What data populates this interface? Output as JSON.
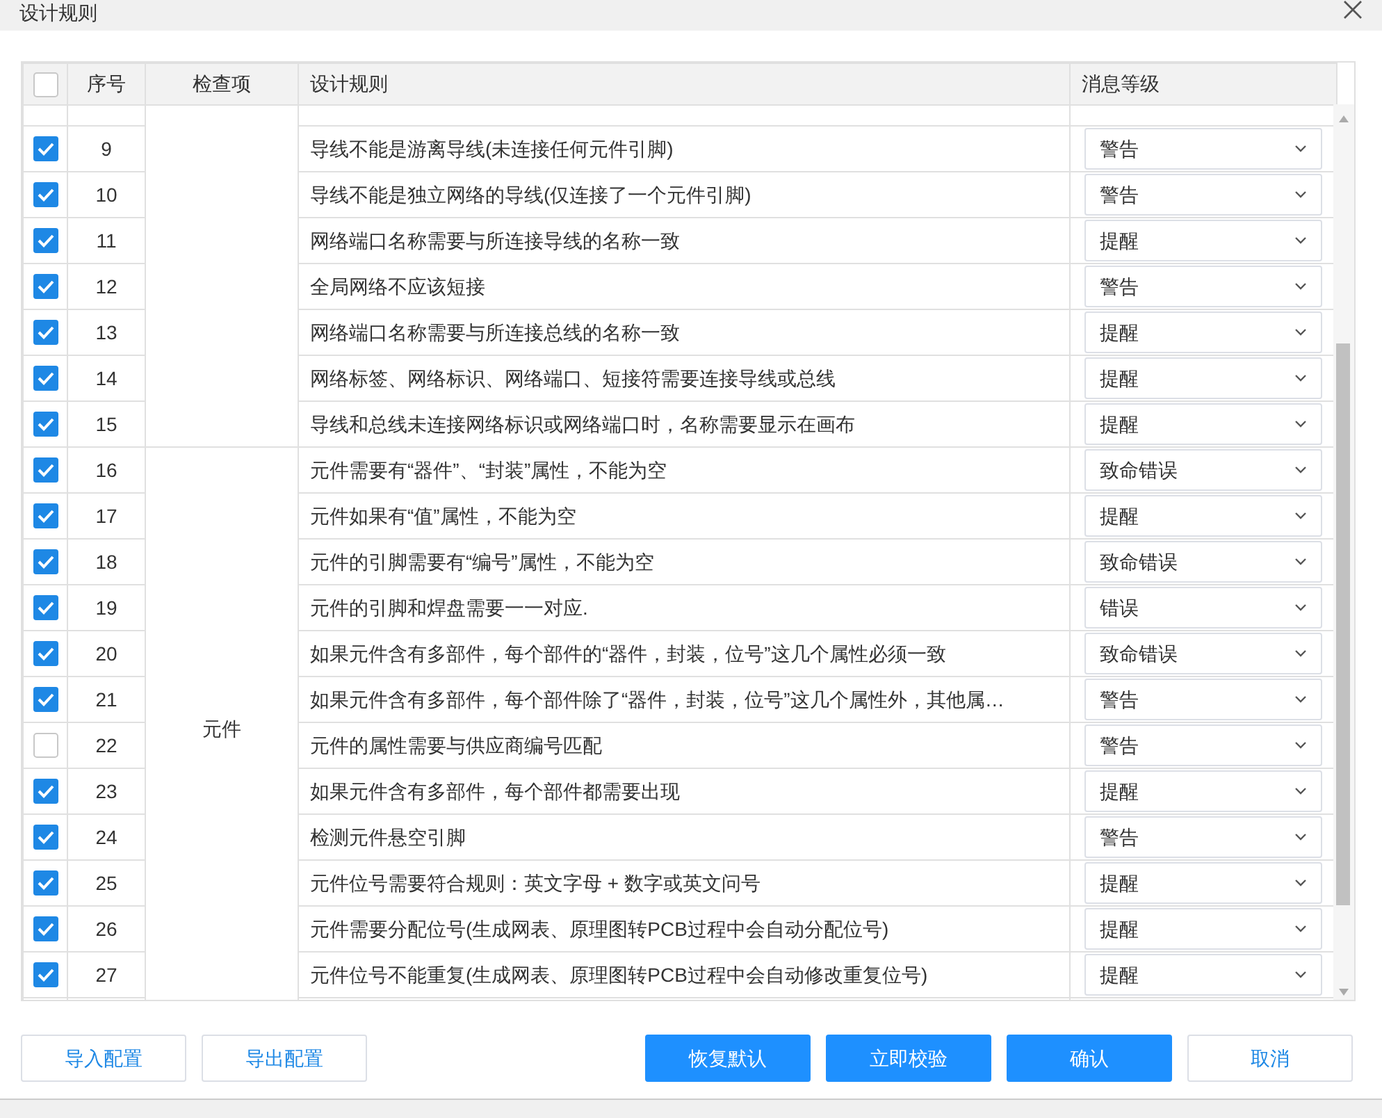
{
  "window": {
    "title": "设计规则"
  },
  "table": {
    "columns": [
      "序号",
      "检查项",
      "设计规则",
      "消息等级"
    ],
    "header_checked": false,
    "groups": [
      {
        "rows": [
          {
            "no": "9",
            "rule": "导线不能是游离导线(未连接任何元件引脚)",
            "level_text": "警告",
            "checked": true
          },
          {
            "no": "10",
            "rule": "导线不能是独立网络的导线(仅连接了一个元件引脚)",
            "level_text": "警告",
            "checked": true
          },
          {
            "no": "11",
            "rule": "网络端口名称需要与所连接导线的名称一致",
            "level_text": "提醒",
            "checked": true
          },
          {
            "no": "12",
            "rule": "全局网络不应该短接",
            "level_text": "警告",
            "checked": true
          },
          {
            "no": "13",
            "rule": "网络端口名称需要与所连接总线的名称一致",
            "level_text": "提醒",
            "checked": true
          },
          {
            "no": "14",
            "rule": "网络标签、网络标识、网络端口、短接符需要连接导线或总线",
            "level_text": "提醒",
            "checked": true
          },
          {
            "no": "15",
            "rule": "导线和总线未连接网络标识或网络端口时，名称需要显示在画布",
            "level_text": "提醒",
            "checked": true
          }
        ]
      },
      {
        "label": "元件",
        "rows": [
          {
            "no": "16",
            "rule": "元件需要有“器件”、“封装”属性，不能为空",
            "level_text": "致命错误",
            "checked": true
          },
          {
            "no": "17",
            "rule": "元件如果有“值”属性，不能为空",
            "level_text": "提醒",
            "checked": true
          },
          {
            "no": "18",
            "rule": "元件的引脚需要有“编号”属性，不能为空",
            "level_text": "致命错误",
            "checked": true
          },
          {
            "no": "19",
            "rule": "元件的引脚和焊盘需要一一对应.",
            "level_text": "错误",
            "checked": true
          },
          {
            "no": "20",
            "rule": "如果元件含有多部件，每个部件的“器件，封装，位号”这几个属性必须一致",
            "level_text": "致命错误",
            "checked": true
          },
          {
            "no": "21",
            "rule": "如果元件含有多部件，每个部件除了“器件，封装，位号”这几个属性外，其他属…",
            "level_text": "警告",
            "checked": true
          },
          {
            "no": "22",
            "rule": "元件的属性需要与供应商编号匹配",
            "level_text": "警告",
            "checked": false
          },
          {
            "no": "23",
            "rule": "如果元件含有多部件，每个部件都需要出现",
            "level_text": "提醒",
            "checked": true
          },
          {
            "no": "24",
            "rule": "检测元件悬空引脚",
            "level_text": "警告",
            "checked": true
          },
          {
            "no": "25",
            "rule": "元件位号需要符合规则：英文字母 + 数字或英文问号",
            "level_text": "提醒",
            "checked": true
          },
          {
            "no": "26",
            "rule": "元件需要分配位号(生成网表、原理图转PCB过程中会自动分配位号)",
            "level_text": "提醒",
            "checked": true
          },
          {
            "no": "27",
            "rule": "元件位号不能重复(生成网表、原理图转PCB过程中会自动修改重复位号)",
            "level_text": "提醒",
            "checked": true
          }
        ]
      }
    ]
  },
  "buttons": [
    {
      "label": "导入配置",
      "kind": "plain"
    },
    {
      "label": "导出配置",
      "kind": "plain"
    },
    {
      "label": "恢复默认",
      "kind": "primary"
    },
    {
      "label": "立即校验",
      "kind": "primary"
    },
    {
      "label": "确认",
      "kind": "primary"
    },
    {
      "label": "取消",
      "kind": "plain"
    }
  ]
}
